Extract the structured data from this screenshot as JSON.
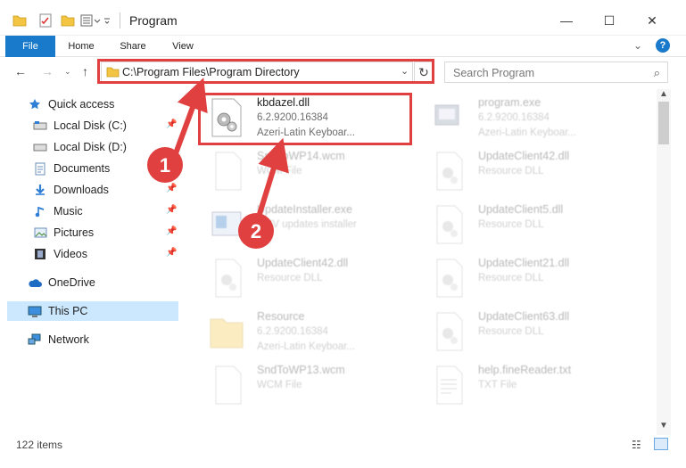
{
  "window": {
    "title": "Program",
    "controls": {
      "minimize": "—",
      "maximize": "☐",
      "close": "✕"
    }
  },
  "ribbon": {
    "tabs": [
      "File",
      "Home",
      "Share",
      "View"
    ],
    "help": "?",
    "accent": "#1979ca"
  },
  "navigation": {
    "address": "C:\\Program Files\\Program Directory",
    "search_placeholder": "Search Program"
  },
  "sidebar": {
    "items": [
      {
        "label": "Quick access",
        "icon": "star-icon"
      },
      {
        "label": "Local Disk (C:)",
        "icon": "drive-icon",
        "pinned": true
      },
      {
        "label": "Local Disk (D:)",
        "icon": "drive-icon"
      },
      {
        "label": "Documents",
        "icon": "document-icon",
        "pinned": true
      },
      {
        "label": "Downloads",
        "icon": "download-icon",
        "pinned": true
      },
      {
        "label": "Music",
        "icon": "music-icon",
        "pinned": true
      },
      {
        "label": "Pictures",
        "icon": "pictures-icon",
        "pinned": true
      },
      {
        "label": "Videos",
        "icon": "video-icon",
        "pinned": true
      },
      {
        "label": "OneDrive",
        "icon": "cloud-icon"
      },
      {
        "label": "This PC",
        "icon": "computer-icon",
        "selected": true
      },
      {
        "label": "Network",
        "icon": "network-icon"
      }
    ]
  },
  "files": [
    {
      "name": "kbdazel.dll",
      "line1": "6.2.9200.16384",
      "line2": "Azeri-Latin Keyboar...",
      "icon": "dll-icon",
      "highlighted": true
    },
    {
      "name": "program.exe",
      "line1": "6.2.9200.16384",
      "line2": "Azeri-Latin Keyboar...",
      "icon": "exe-icon"
    },
    {
      "name": "SndToWP14.wcm",
      "line1": "WCM File",
      "line2": "",
      "icon": "file-icon"
    },
    {
      "name": "UpdateClient42.dll",
      "line1": "Resource DLL",
      "line2": "",
      "icon": "dll-icon"
    },
    {
      "name": "UpdateInstaller.exe",
      "line1": "SMV updates installer",
      "line2": "",
      "icon": "installer-icon"
    },
    {
      "name": "UpdateClient5.dll",
      "line1": "Resource DLL",
      "line2": "",
      "icon": "dll-icon"
    },
    {
      "name": "UpdateClient42.dll",
      "line1": "Resource DLL",
      "line2": "",
      "icon": "dll-icon"
    },
    {
      "name": "UpdateClient21.dll",
      "line1": "Resource DLL",
      "line2": "",
      "icon": "dll-icon"
    },
    {
      "name": "Resource",
      "line1": "6.2.9200.16384",
      "line2": "Azeri-Latin Keyboar...",
      "icon": "folder-icon"
    },
    {
      "name": "UpdateClient63.dll",
      "line1": "Resource DLL",
      "line2": "",
      "icon": "dll-icon"
    },
    {
      "name": "SndToWP13.wcm",
      "line1": "WCM File",
      "line2": "",
      "icon": "file-icon"
    },
    {
      "name": "help.fineReader.txt",
      "line1": "TXT File",
      "line2": "",
      "icon": "text-file-icon"
    }
  ],
  "status": {
    "item_count": "122 items"
  },
  "annotations": {
    "callouts": [
      "1",
      "2"
    ],
    "color": "#e04040"
  }
}
